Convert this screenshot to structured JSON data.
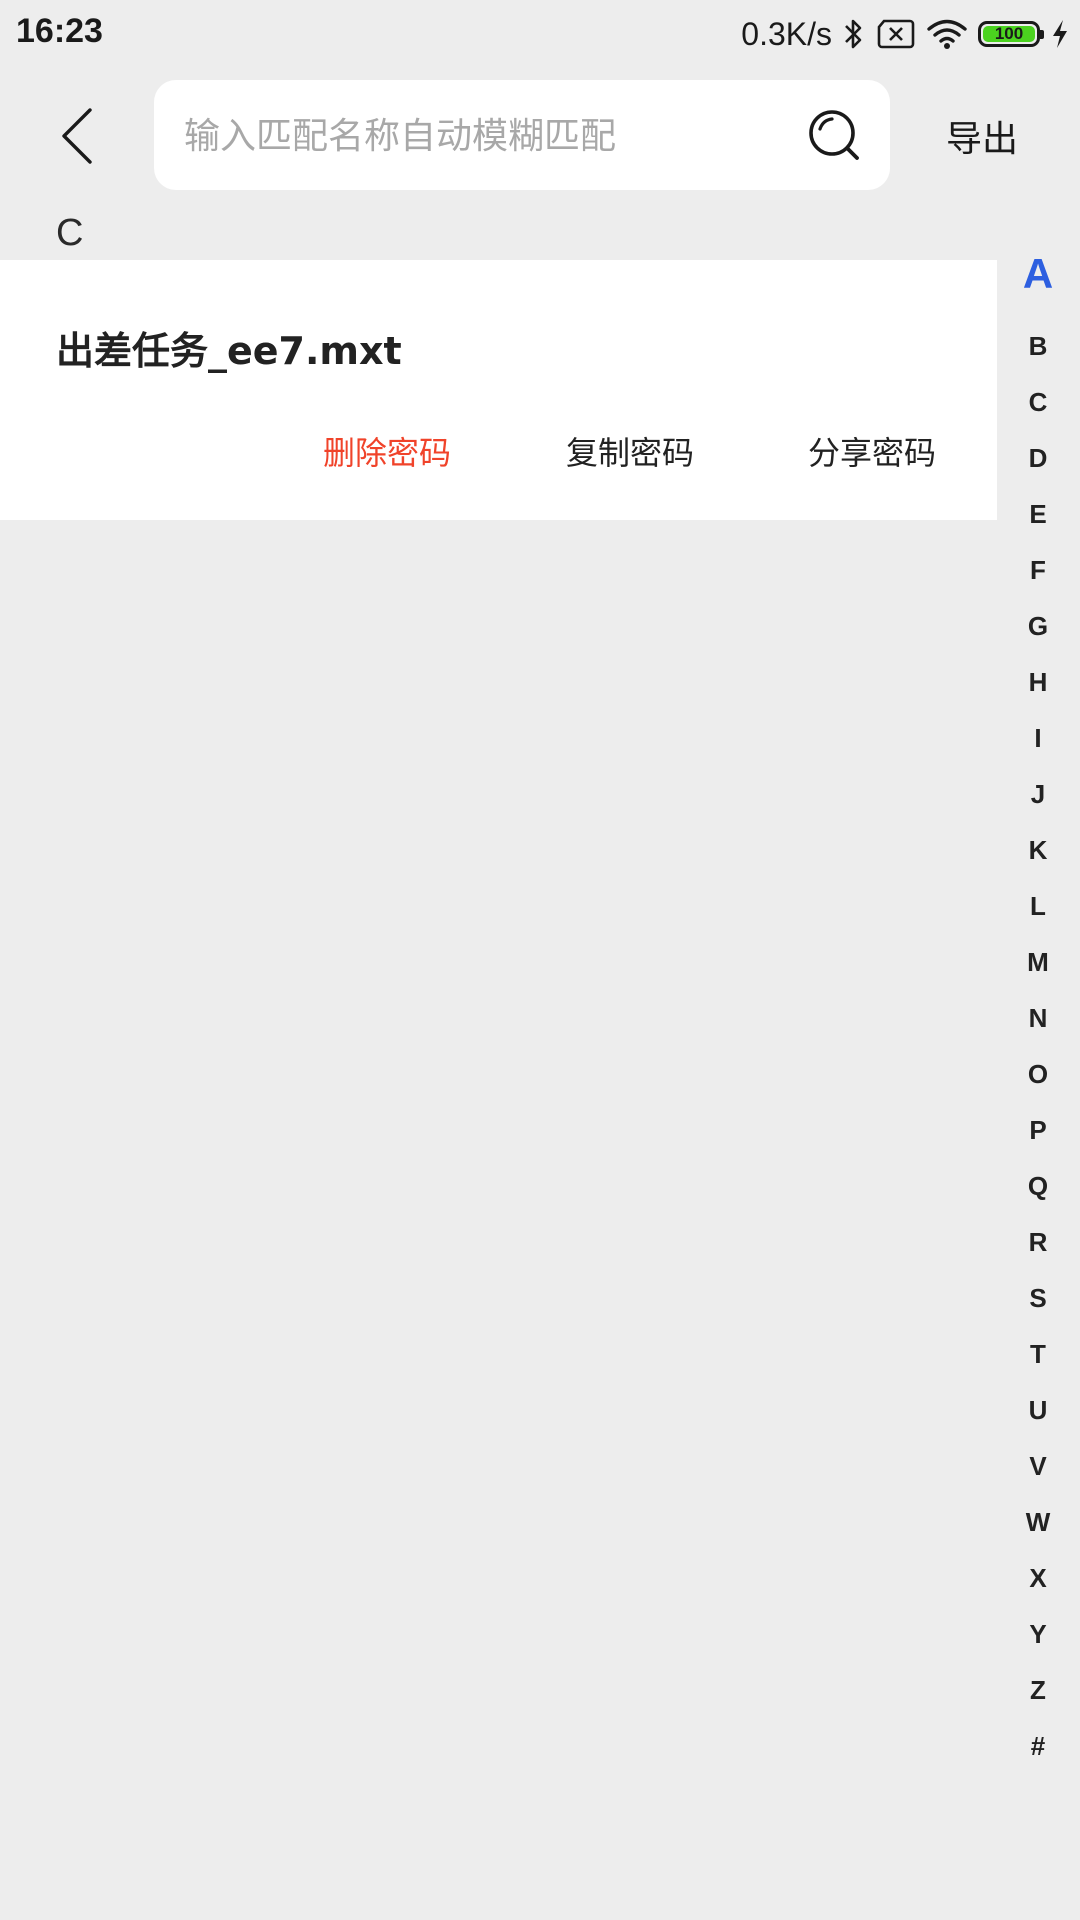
{
  "status_bar": {
    "time": "16:23",
    "net_speed": "0.3K/s",
    "battery_level": "100",
    "icons": [
      "bluetooth-icon",
      "sim-x-icon",
      "wifi-icon",
      "battery-icon",
      "charging-bolt-icon"
    ]
  },
  "header": {
    "back_icon": "chevron-left-icon",
    "search_placeholder": "输入匹配名称自动模糊匹配",
    "search_value": "",
    "search_icon": "search-icon",
    "export_label": "导出"
  },
  "list": {
    "section_letter": "C",
    "items": [
      {
        "title": "出差任务_ee7.mxt",
        "actions": {
          "delete": "删除密码",
          "copy": "复制密码",
          "share": "分享密码"
        }
      }
    ]
  },
  "alpha_index": {
    "active": "A",
    "letters": [
      "A",
      "B",
      "C",
      "D",
      "E",
      "F",
      "G",
      "H",
      "I",
      "J",
      "K",
      "L",
      "M",
      "N",
      "O",
      "P",
      "Q",
      "R",
      "S",
      "T",
      "U",
      "V",
      "W",
      "X",
      "Y",
      "Z",
      "#"
    ]
  },
  "colors": {
    "background": "#ededed",
    "card": "#ffffff",
    "delete": "#f0432a",
    "index_active": "#2d5fe0",
    "battery_fill": "#4bd31f"
  }
}
